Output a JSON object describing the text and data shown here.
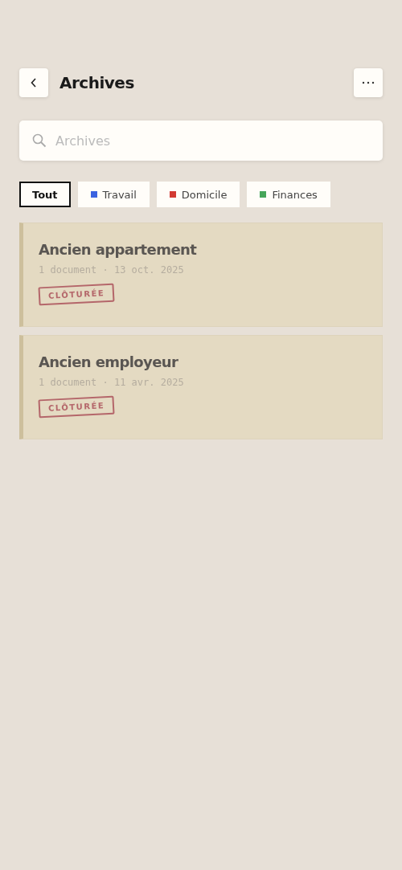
{
  "header": {
    "title": "Archives"
  },
  "search": {
    "placeholder": "Archives"
  },
  "filters": [
    {
      "label": "Tout",
      "selected": true
    },
    {
      "label": "Travail",
      "selected": false,
      "color": "#3b63e0"
    },
    {
      "label": "Domicile",
      "selected": false,
      "color": "#d23a33"
    },
    {
      "label": "Finances",
      "selected": false,
      "color": "#46a55a"
    }
  ],
  "folders": [
    {
      "title": "Ancien appartement",
      "meta": "1 document · 13 oct. 2025",
      "stamp": "CLÔTURÉE"
    },
    {
      "title": "Ancien employeur",
      "meta": "1 document · 11 avr. 2025",
      "stamp": "CLÔTURÉE"
    }
  ]
}
